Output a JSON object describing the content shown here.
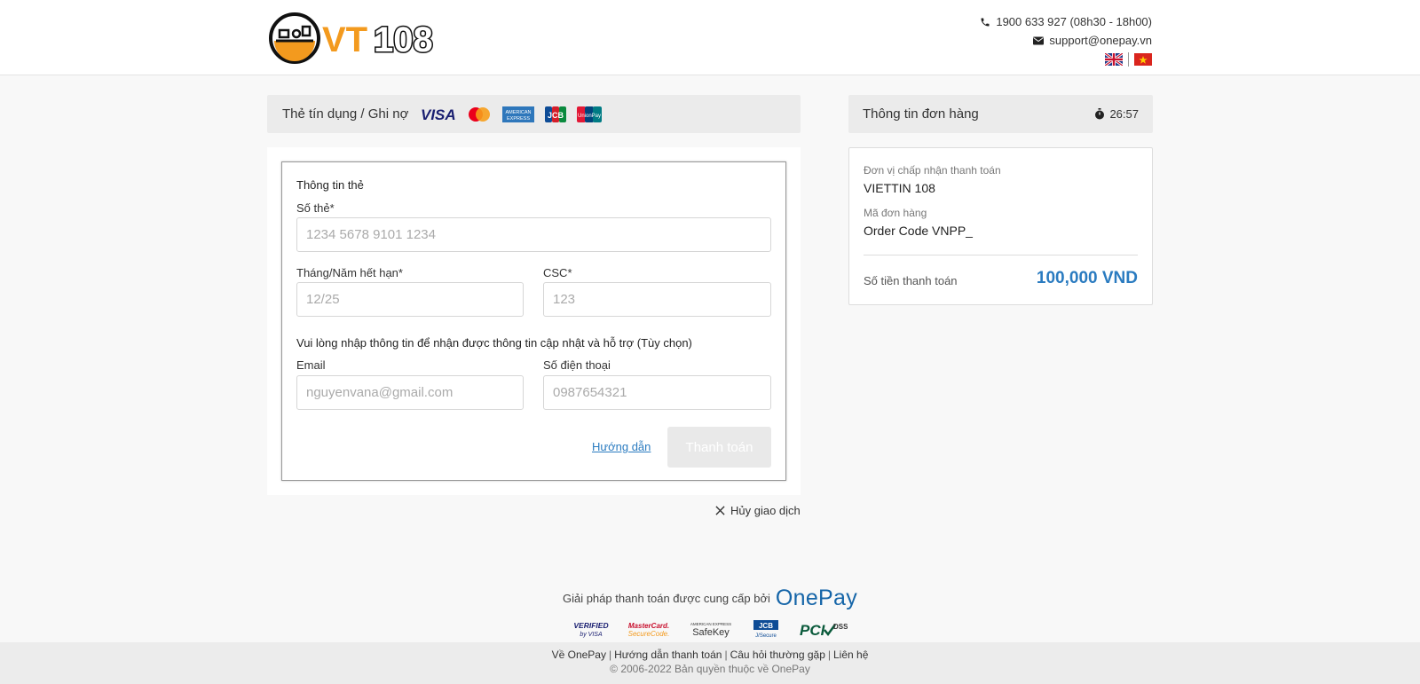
{
  "header": {
    "logo_text": "VT108",
    "phone": "1900 633 927 (08h30 - 18h00)",
    "email": "support@onepay.vn",
    "flags": [
      "english-flag",
      "vietnam-flag"
    ]
  },
  "payment_method": {
    "title": "Thẻ tín dụng / Ghi nợ",
    "card_brands": [
      "VISA",
      "Mastercard",
      "American Express",
      "JCB",
      "UnionPay"
    ]
  },
  "card_form": {
    "section_title": "Thông tin thẻ",
    "card_number_label": "Số thẻ*",
    "card_number_placeholder": "1234 5678 9101 1234",
    "expiry_label": "Tháng/Năm hết hạn*",
    "expiry_placeholder": "12/25",
    "csc_label": "CSC*",
    "csc_placeholder": "123",
    "optional_note": "Vui lòng nhập thông tin để nhận được thông tin cập nhật và hỗ trợ (Tùy chọn)",
    "email_label": "Email",
    "email_placeholder": "nguyenvana@gmail.com",
    "phone_label": "Số điện thoại",
    "phone_placeholder": "0987654321",
    "help_link": "Hướng dẫn",
    "pay_button": "Thanh toán"
  },
  "cancel_label": "Hủy giao dịch",
  "order": {
    "title": "Thông tin đơn hàng",
    "timer": "26:57",
    "merchant_label": "Đơn vị chấp nhận thanh toán",
    "merchant_value": "VIETTIN 108",
    "order_code_label": "Mã đơn hàng",
    "order_code_value": "Order Code VNPP_",
    "amount_label": "Số tiền thanh toán",
    "amount_value": "100,000 VND"
  },
  "footer": {
    "provided_by": "Giải pháp thanh toán được cung cấp bởi",
    "provider_logo": "OnePay",
    "security_badges": [
      "Verified by VISA",
      "MasterCard SecureCode",
      "SafeKey",
      "JCB J/Secure",
      "PCI DSS"
    ],
    "links": [
      "Về OnePay",
      "Hướng dẫn thanh toán",
      "Câu hỏi thường gặp",
      "Liên hệ"
    ],
    "copyright": "© 2006-2022 Bản quyền thuộc về OnePay"
  },
  "colors": {
    "accent": "#2a7bc0",
    "logo_orange": "#f39a1e",
    "background": "#f8f8f8"
  }
}
